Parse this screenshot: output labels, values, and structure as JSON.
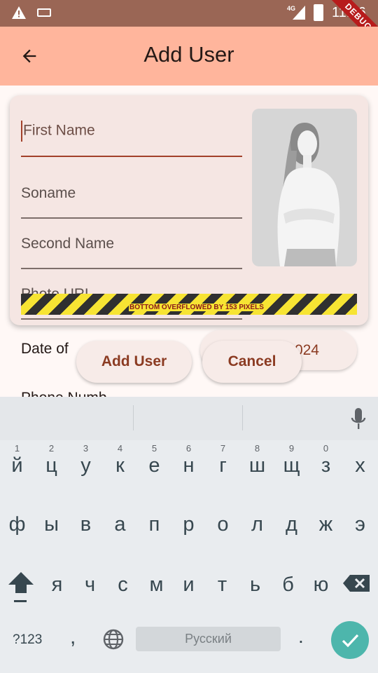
{
  "status_bar": {
    "network": "4G",
    "time": "11:36",
    "debug_banner": "DEBUG"
  },
  "app_bar": {
    "title": "Add User",
    "back_icon": "arrow-back-icon"
  },
  "form": {
    "first_name": {
      "placeholder": "First Name"
    },
    "soname": {
      "placeholder": "Soname"
    },
    "second_name": {
      "placeholder": "Second Name"
    },
    "photo_url": {
      "placeholder": "Photo URL"
    },
    "photo_icon": "user-photo-placeholder",
    "overflow_warning": "BOTTOM OVERFLOWED BY 153 PIXELS",
    "date_of_birth_label": "Date of",
    "date_value": "024",
    "phone_label": "Phone Numb"
  },
  "buttons": {
    "add_user": "Add User",
    "cancel": "Cancel"
  },
  "keyboard": {
    "row1": [
      {
        "num": "1",
        "ch": "й"
      },
      {
        "num": "2",
        "ch": "ц"
      },
      {
        "num": "3",
        "ch": "у"
      },
      {
        "num": "4",
        "ch": "к"
      },
      {
        "num": "5",
        "ch": "е"
      },
      {
        "num": "6",
        "ch": "н"
      },
      {
        "num": "7",
        "ch": "г"
      },
      {
        "num": "8",
        "ch": "ш"
      },
      {
        "num": "9",
        "ch": "щ"
      },
      {
        "num": "0",
        "ch": "з"
      },
      {
        "num": "",
        "ch": "х"
      }
    ],
    "row2": [
      "ф",
      "ы",
      "в",
      "а",
      "п",
      "р",
      "о",
      "л",
      "д",
      "ж",
      "э"
    ],
    "row3": [
      "я",
      "ч",
      "с",
      "м",
      "и",
      "т",
      "ь",
      "б",
      "ю"
    ],
    "symbols_label": "?123",
    "comma": ",",
    "space_label": "Русский",
    "period": ".",
    "accent_color": "#4db6ac"
  }
}
